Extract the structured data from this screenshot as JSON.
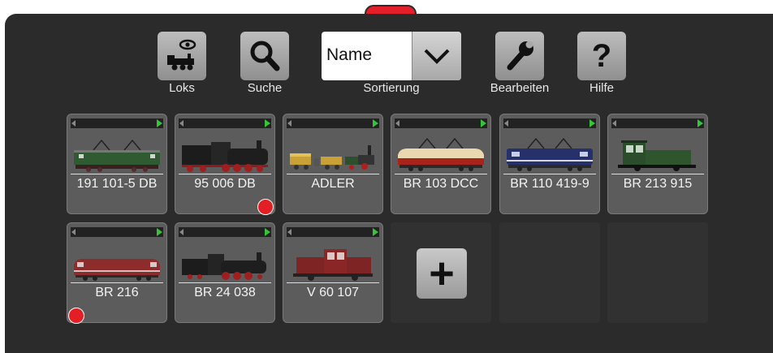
{
  "toolbar": {
    "loks_label": "Loks",
    "suche_label": "Suche",
    "sort_label": "Sortierung",
    "sort_value": "Name",
    "bearbeiten_label": "Bearbeiten",
    "hilfe_label": "Hilfe",
    "hilfe_glyph": "?",
    "add_glyph": "+"
  },
  "locomotives": [
    {
      "name": "191 101-5 DB",
      "icon": "electric-locomotive-green",
      "marked": false
    },
    {
      "name": "95 006 DB",
      "icon": "steam-locomotive-black",
      "marked": true
    },
    {
      "name": "ADLER",
      "icon": "historic-train-adler",
      "marked": false
    },
    {
      "name": "BR 103 DCC",
      "icon": "electric-locomotive-cream-red",
      "marked": false
    },
    {
      "name": "BR 110 419-9",
      "icon": "electric-locomotive-blue",
      "marked": false
    },
    {
      "name": "BR 213 915",
      "icon": "shunter-locomotive-green",
      "marked": false
    },
    {
      "name": "BR 216",
      "icon": "diesel-locomotive-red",
      "marked": true
    },
    {
      "name": "BR 24 038",
      "icon": "steam-locomotive-black",
      "marked": false
    },
    {
      "name": "V 60 107",
      "icon": "diesel-shunter-red",
      "marked": false
    }
  ],
  "colors": {
    "panel": "#2b2b2b",
    "handle": "#e3202a",
    "marker": "#e31e24",
    "arrow": "#35c43a"
  }
}
